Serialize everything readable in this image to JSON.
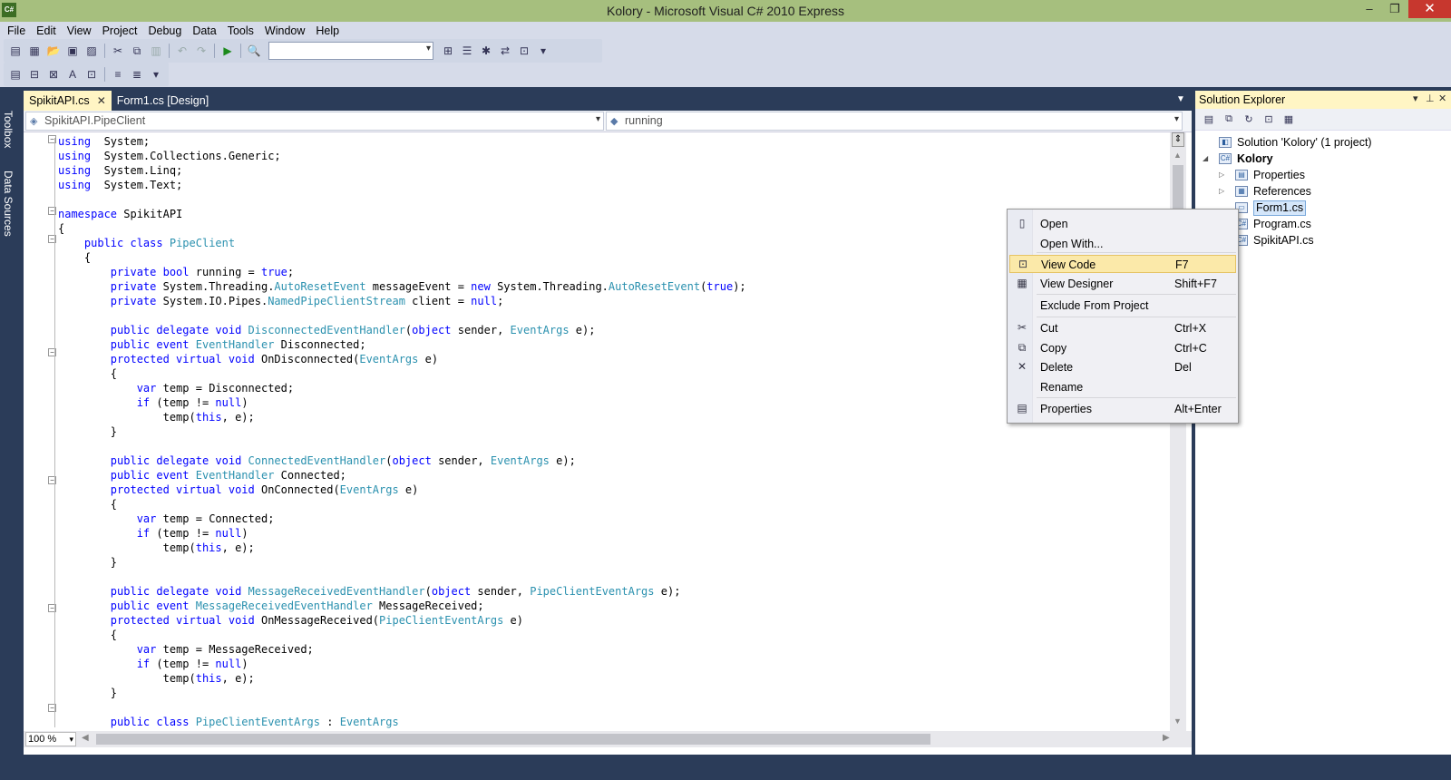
{
  "window": {
    "title": "Kolory - Microsoft Visual C# 2010 Express",
    "app_badge": "C#"
  },
  "menu": [
    "File",
    "Edit",
    "View",
    "Project",
    "Debug",
    "Data",
    "Tools",
    "Window",
    "Help"
  ],
  "side_dock": [
    "Toolbox",
    "Data Sources"
  ],
  "tabs": [
    {
      "label": "SpikitAPI.cs",
      "active": true
    },
    {
      "label": "Form1.cs [Design]",
      "active": false
    }
  ],
  "nav": {
    "type_combo": "SpikitAPI.PipeClient",
    "member_combo": "running"
  },
  "zoom": "100 %",
  "code_lines": [
    [
      [
        "kw",
        "using"
      ],
      [
        "",
        "  System;"
      ]
    ],
    [
      [
        "kw",
        "using"
      ],
      [
        "",
        "  System.Collections.Generic;"
      ]
    ],
    [
      [
        "kw",
        "using"
      ],
      [
        "",
        "  System.Linq;"
      ]
    ],
    [
      [
        "kw",
        "using"
      ],
      [
        "",
        "  System.Text;"
      ]
    ],
    [],
    [
      [
        "kw",
        "namespace"
      ],
      [
        "",
        " SpikitAPI"
      ]
    ],
    [
      [
        "",
        "{"
      ]
    ],
    [
      [
        "",
        "    "
      ],
      [
        "kw",
        "public class"
      ],
      [
        "",
        " "
      ],
      [
        "ty",
        "PipeClient"
      ]
    ],
    [
      [
        "",
        "    {"
      ]
    ],
    [
      [
        "",
        "        "
      ],
      [
        "kw",
        "private bool"
      ],
      [
        "",
        " running = "
      ],
      [
        "kw",
        "true"
      ],
      [
        "",
        ";"
      ]
    ],
    [
      [
        "",
        "        "
      ],
      [
        "kw",
        "private"
      ],
      [
        "",
        " System.Threading."
      ],
      [
        "ty",
        "AutoResetEvent"
      ],
      [
        "",
        " messageEvent = "
      ],
      [
        "kw",
        "new"
      ],
      [
        "",
        " System.Threading."
      ],
      [
        "ty",
        "AutoResetEvent"
      ],
      [
        "",
        "("
      ],
      [
        "kw",
        "true"
      ],
      [
        "",
        ");"
      ]
    ],
    [
      [
        "",
        "        "
      ],
      [
        "kw",
        "private"
      ],
      [
        "",
        " System.IO.Pipes."
      ],
      [
        "ty",
        "NamedPipeClientStream"
      ],
      [
        "",
        " client = "
      ],
      [
        "kw",
        "null"
      ],
      [
        "",
        ";"
      ]
    ],
    [],
    [
      [
        "",
        "        "
      ],
      [
        "kw",
        "public delegate void"
      ],
      [
        "",
        " "
      ],
      [
        "ty",
        "DisconnectedEventHandler"
      ],
      [
        "",
        "("
      ],
      [
        "kw",
        "object"
      ],
      [
        "",
        " sender, "
      ],
      [
        "ty",
        "EventArgs"
      ],
      [
        "",
        " e);"
      ]
    ],
    [
      [
        "",
        "        "
      ],
      [
        "kw",
        "public event"
      ],
      [
        "",
        " "
      ],
      [
        "ty",
        "EventHandler"
      ],
      [
        "",
        " Disconnected;"
      ]
    ],
    [
      [
        "",
        "        "
      ],
      [
        "kw",
        "protected virtual void"
      ],
      [
        "",
        " OnDisconnected("
      ],
      [
        "ty",
        "EventArgs"
      ],
      [
        "",
        " e)"
      ]
    ],
    [
      [
        "",
        "        {"
      ]
    ],
    [
      [
        "",
        "            "
      ],
      [
        "kw",
        "var"
      ],
      [
        "",
        " temp = Disconnected;"
      ]
    ],
    [
      [
        "",
        "            "
      ],
      [
        "kw",
        "if"
      ],
      [
        "",
        " (temp != "
      ],
      [
        "kw",
        "null"
      ],
      [
        "",
        ")"
      ]
    ],
    [
      [
        "",
        "                temp("
      ],
      [
        "kw",
        "this"
      ],
      [
        "",
        ", e);"
      ]
    ],
    [
      [
        "",
        "        }"
      ]
    ],
    [],
    [
      [
        "",
        "        "
      ],
      [
        "kw",
        "public delegate void"
      ],
      [
        "",
        " "
      ],
      [
        "ty",
        "ConnectedEventHandler"
      ],
      [
        "",
        "("
      ],
      [
        "kw",
        "object"
      ],
      [
        "",
        " sender, "
      ],
      [
        "ty",
        "EventArgs"
      ],
      [
        "",
        " e);"
      ]
    ],
    [
      [
        "",
        "        "
      ],
      [
        "kw",
        "public event"
      ],
      [
        "",
        " "
      ],
      [
        "ty",
        "EventHandler"
      ],
      [
        "",
        " Connected;"
      ]
    ],
    [
      [
        "",
        "        "
      ],
      [
        "kw",
        "protected virtual void"
      ],
      [
        "",
        " OnConnected("
      ],
      [
        "ty",
        "EventArgs"
      ],
      [
        "",
        " e)"
      ]
    ],
    [
      [
        "",
        "        {"
      ]
    ],
    [
      [
        "",
        "            "
      ],
      [
        "kw",
        "var"
      ],
      [
        "",
        " temp = Connected;"
      ]
    ],
    [
      [
        "",
        "            "
      ],
      [
        "kw",
        "if"
      ],
      [
        "",
        " (temp != "
      ],
      [
        "kw",
        "null"
      ],
      [
        "",
        ")"
      ]
    ],
    [
      [
        "",
        "                temp("
      ],
      [
        "kw",
        "this"
      ],
      [
        "",
        ", e);"
      ]
    ],
    [
      [
        "",
        "        }"
      ]
    ],
    [],
    [
      [
        "",
        "        "
      ],
      [
        "kw",
        "public delegate void"
      ],
      [
        "",
        " "
      ],
      [
        "ty",
        "MessageReceivedEventHandler"
      ],
      [
        "",
        "("
      ],
      [
        "kw",
        "object"
      ],
      [
        "",
        " sender, "
      ],
      [
        "ty",
        "PipeClientEventArgs"
      ],
      [
        "",
        " e);"
      ]
    ],
    [
      [
        "",
        "        "
      ],
      [
        "kw",
        "public event"
      ],
      [
        "",
        " "
      ],
      [
        "ty",
        "MessageReceivedEventHandler"
      ],
      [
        "",
        " MessageReceived;"
      ]
    ],
    [
      [
        "",
        "        "
      ],
      [
        "kw",
        "protected virtual void"
      ],
      [
        "",
        " OnMessageReceived("
      ],
      [
        "ty",
        "PipeClientEventArgs"
      ],
      [
        "",
        " e)"
      ]
    ],
    [
      [
        "",
        "        {"
      ]
    ],
    [
      [
        "",
        "            "
      ],
      [
        "kw",
        "var"
      ],
      [
        "",
        " temp = MessageReceived;"
      ]
    ],
    [
      [
        "",
        "            "
      ],
      [
        "kw",
        "if"
      ],
      [
        "",
        " (temp != "
      ],
      [
        "kw",
        "null"
      ],
      [
        "",
        ")"
      ]
    ],
    [
      [
        "",
        "                temp("
      ],
      [
        "kw",
        "this"
      ],
      [
        "",
        ", e);"
      ]
    ],
    [
      [
        "",
        "        }"
      ]
    ],
    [],
    [
      [
        "",
        "        "
      ],
      [
        "kw",
        "public class"
      ],
      [
        "",
        " "
      ],
      [
        "ty",
        "PipeClientEventArgs"
      ],
      [
        "",
        " : "
      ],
      [
        "ty",
        "EventArgs"
      ]
    ],
    [
      [
        "",
        "        {"
      ]
    ]
  ],
  "solution_explorer": {
    "title": "Solution Explorer",
    "items": [
      {
        "label": "Solution 'Kolory' (1 project)",
        "level": 0,
        "icon": "solution-icon"
      },
      {
        "label": "Kolory",
        "level": 1,
        "icon": "csharp-project-icon",
        "bold": true,
        "expanded": true
      },
      {
        "label": "Properties",
        "level": 2,
        "icon": "properties-folder-icon",
        "collapsed": true
      },
      {
        "label": "References",
        "level": 2,
        "icon": "references-folder-icon",
        "collapsed": true
      },
      {
        "label": "Form1.cs",
        "level": 2,
        "icon": "form-file-icon",
        "selected": true
      },
      {
        "label": "Program.cs",
        "level": 2,
        "icon": "cs-file-icon"
      },
      {
        "label": "SpikitAPI.cs",
        "level": 2,
        "icon": "cs-file-icon"
      }
    ]
  },
  "context_menu": [
    {
      "label": "Open",
      "shortcut": "",
      "icon": "open-icon"
    },
    {
      "label": "Open With...",
      "shortcut": "",
      "icon": ""
    },
    {
      "label": "View Code",
      "shortcut": "F7",
      "icon": "view-code-icon",
      "highlighted": true
    },
    {
      "label": "View Designer",
      "shortcut": "Shift+F7",
      "icon": "view-designer-icon"
    },
    {
      "label": "Exclude From Project",
      "shortcut": "",
      "icon": ""
    },
    {
      "label": "Cut",
      "shortcut": "Ctrl+X",
      "icon": "cut-icon"
    },
    {
      "label": "Copy",
      "shortcut": "Ctrl+C",
      "icon": "copy-icon"
    },
    {
      "label": "Delete",
      "shortcut": "Del",
      "icon": "delete-icon"
    },
    {
      "label": "Rename",
      "shortcut": "",
      "icon": ""
    },
    {
      "label": "Properties",
      "shortcut": "Alt+Enter",
      "icon": "properties-icon"
    }
  ],
  "colors": {
    "title_bar": "#a6bf7e",
    "shell": "#2b3c59",
    "keyword": "#0000ff",
    "type": "#2b91af",
    "highlight": "#fbe9a9"
  }
}
